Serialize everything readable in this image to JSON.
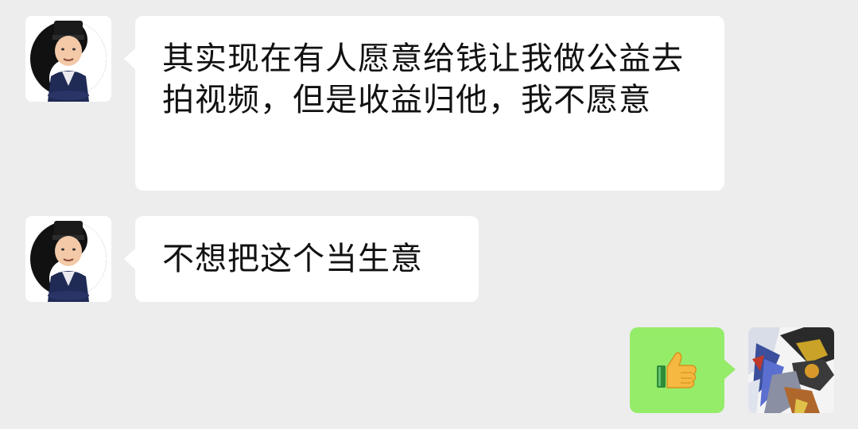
{
  "conversation": {
    "messages": [
      {
        "sender": "contact",
        "text": "其实现在有人愿意给钱让我做公益去拍视频，但是收益归他，我不愿意"
      },
      {
        "sender": "contact",
        "text": "不想把这个当生意"
      },
      {
        "sender": "self",
        "emoji": "thumbs-up-icon"
      }
    ]
  },
  "colors": {
    "background": "#ededed",
    "incoming_bubble": "#ffffff",
    "outgoing_bubble": "#95ec69",
    "text": "#111111"
  }
}
